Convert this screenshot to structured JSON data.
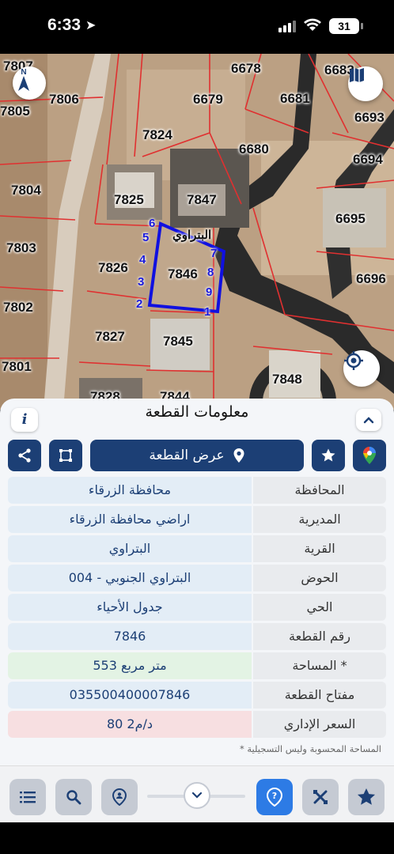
{
  "status": {
    "time": "6:33",
    "battery": "31"
  },
  "map": {
    "parcels": [
      "7807",
      "7806",
      "7805",
      "7824",
      "6678",
      "6679",
      "6681",
      "6683",
      "6693",
      "6680",
      "6694",
      "7804",
      "7825",
      "7847",
      "7803",
      "7826",
      "7846",
      "6695",
      "6696",
      "7802",
      "7827",
      "7845",
      "7801",
      "7848",
      "7828",
      "7844"
    ],
    "village_overlay": "البتراوي",
    "vertices": [
      "1",
      "2",
      "3",
      "4",
      "5",
      "6",
      "7",
      "8",
      "9"
    ],
    "north_label": "N",
    "boundary_color": "#1010e0",
    "parcel_line_color": "#e03030"
  },
  "panel": {
    "title": "معلومات القطعة",
    "info_label": "i",
    "show_plot_label": "عرض القطعة",
    "rows": [
      {
        "label": "المحافظة",
        "value": "محافظة الزرقاء",
        "color": "#e3edf6"
      },
      {
        "label": "المديرية",
        "value": "اراضي محافظة الزرقاء",
        "color": "#e3edf6"
      },
      {
        "label": "القرية",
        "value": "البتراوي",
        "color": "#e3edf6"
      },
      {
        "label": "الحوض",
        "value": "البتراوي الجنوبي - 004",
        "color": "#e3edf6"
      },
      {
        "label": "الحي",
        "value": "جدول الأحياء",
        "color": "#e3edf6"
      },
      {
        "label": "رقم القطعة",
        "value": "7846",
        "color": "#e3edf6"
      },
      {
        "label": "المساحة *",
        "value": "553  متر مربع",
        "color": "#e3f3e4"
      },
      {
        "label": "مفتاح القطعة",
        "value": "03550040000784‎6",
        "color": "#e3edf6"
      },
      {
        "label": "السعر الإداري",
        "value": "80 د/م2",
        "color": "#f7dfe1"
      }
    ],
    "footnote": "* المساحة المحسوبة وليس التسجيلية"
  },
  "accent": "#1c3f75"
}
